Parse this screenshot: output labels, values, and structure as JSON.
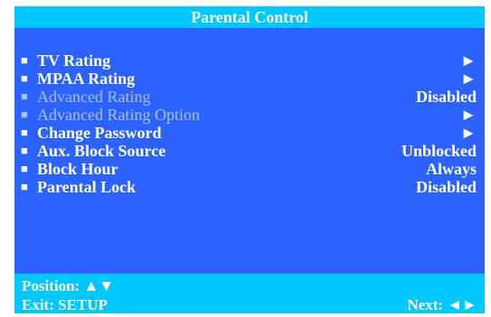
{
  "window": {
    "title": "Parental Control"
  },
  "menu": {
    "bullet": "■",
    "items": [
      {
        "label": "TV Rating",
        "value": "►",
        "enabled": true
      },
      {
        "label": "MPAA Rating",
        "value": "►",
        "enabled": true
      },
      {
        "label": "Advanced Rating",
        "value": "Disabled",
        "enabled": false
      },
      {
        "label": "Advanced Rating Option",
        "value": "►",
        "enabled": false
      },
      {
        "label": "Change Password",
        "value": "►",
        "enabled": true
      },
      {
        "label": "Aux. Block Source",
        "value": "Unblocked",
        "enabled": true
      },
      {
        "label": "Block Hour",
        "value": "Always",
        "enabled": true
      },
      {
        "label": "Parental Lock",
        "value": "Disabled",
        "enabled": true
      }
    ]
  },
  "footer": {
    "position_label": "Position: ▲▼",
    "exit_label": "Exit: SETUP",
    "next_label": "Next: ◄►"
  },
  "colors": {
    "background": "#2c62ff",
    "title_bar": "#00c8ff",
    "footer_bar": "#00c8ff",
    "text": "#ffffff",
    "disabled_text": "#a9bff6"
  }
}
